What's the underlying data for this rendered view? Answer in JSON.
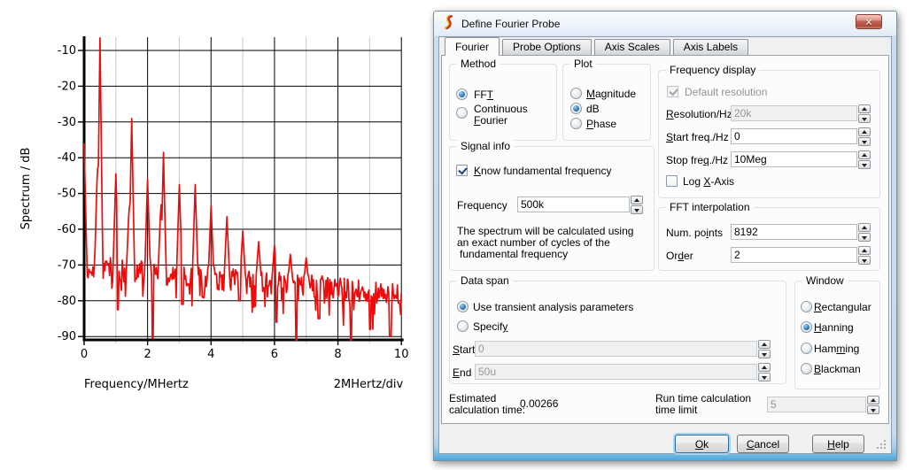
{
  "window": {
    "title": "Define Fourier Probe",
    "close_glyph": "✕"
  },
  "tabs": [
    {
      "label": "Fourier",
      "active": true
    },
    {
      "label": "Probe Options",
      "active": false
    },
    {
      "label": "Axis Scales",
      "active": false
    },
    {
      "label": "Axis Labels",
      "active": false
    }
  ],
  "fourier": {
    "method": {
      "title": "Method",
      "fft": {
        "label": "FFT",
        "selected": true
      },
      "continuous": {
        "label": "Continuous Fourier",
        "selected": false
      }
    },
    "plot": {
      "title": "Plot",
      "magnitude": {
        "label": "Magnitude",
        "selected": false
      },
      "db": {
        "label": "dB",
        "selected": true
      },
      "phase": {
        "label": "Phase",
        "selected": false
      }
    },
    "signal": {
      "title": "Signal info",
      "know": {
        "label": "Know fundamental frequency",
        "checked": true
      },
      "frequency": {
        "label": "Frequency",
        "value": "500k"
      },
      "note": [
        "The spectrum will be calculated using",
        "an exact number of cycles of the",
        "fundamental frequency"
      ]
    },
    "freq_display": {
      "title": "Frequency display",
      "default_res": {
        "label": "Default resolution",
        "checked": true,
        "disabled": true
      },
      "resolution": {
        "label": "Resolution/Hz",
        "value": "20k",
        "disabled": true
      },
      "start": {
        "label": "Start freq./Hz",
        "value": "0",
        "disabled": false
      },
      "stop": {
        "label": "Stop freq./Hz",
        "value": "10Meg",
        "disabled": false
      },
      "logx": {
        "label": "Log X-Axis",
        "checked": false
      }
    },
    "fft_interp": {
      "title": "FFT interpolation",
      "num_points": {
        "label": "Num. points",
        "value": "8192"
      },
      "order": {
        "label": "Order",
        "value": "2"
      }
    },
    "data_span": {
      "title": "Data span",
      "use_transient": {
        "label": "Use transient analysis parameters",
        "selected": true
      },
      "specify": {
        "label": "Specify",
        "selected": false
      },
      "start": {
        "label": "Start",
        "value": "0",
        "disabled": true
      },
      "end": {
        "label": "End",
        "value": "50u",
        "disabled": true
      }
    },
    "window_fn": {
      "title": "Window",
      "rectangular": {
        "label": "Rectangular",
        "selected": false
      },
      "hanning": {
        "label": "Hanning",
        "selected": true
      },
      "hamming": {
        "label": "Hamming",
        "selected": false
      },
      "blackman": {
        "label": "Blackman",
        "selected": false
      }
    },
    "estimated": {
      "line1": "Estimated",
      "line2": "calculation time:",
      "value": "0.00266"
    },
    "run_limit": {
      "line1": "Run time calculation",
      "line2": "time limit",
      "value": "5",
      "disabled": true
    }
  },
  "buttons": {
    "ok": "Ok",
    "cancel": "Cancel",
    "help": "Help"
  },
  "chart_data": {
    "type": "line",
    "title": "",
    "xlabel": "Frequency/MHertz",
    "xlabel_right": "2MHertz/div",
    "ylabel": "Spectrum / dB",
    "xlim": [
      0,
      10
    ],
    "ylim": [
      -91,
      -6.4
    ],
    "x_ticks": [
      0,
      2,
      4,
      6,
      8,
      10
    ],
    "x_minor_step": 1,
    "y_ticks": [
      -10,
      -20,
      -30,
      -40,
      -50,
      -60,
      -70,
      -80,
      -90
    ],
    "grid": true,
    "legend": "none",
    "line_color": "#ee0b0b",
    "series_name": "spectrum",
    "fundamental_hz": "500k",
    "harmonics_mhz_db": [
      [
        0.0,
        -36
      ],
      [
        0.42,
        -41.5
      ],
      [
        0.5,
        -6.5
      ],
      [
        1.0,
        -44.5
      ],
      [
        1.42,
        -53
      ],
      [
        1.5,
        -29
      ],
      [
        2.0,
        -46
      ],
      [
        2.42,
        -52
      ],
      [
        2.5,
        -38.5
      ],
      [
        3.0,
        -47.5
      ],
      [
        3.5,
        -47.5
      ],
      [
        4.0,
        -53.5
      ],
      [
        4.5,
        -56.5
      ],
      [
        5.0,
        -60.5
      ],
      [
        5.5,
        -63.5
      ],
      [
        6.0,
        -64.5
      ],
      [
        6.5,
        -67
      ],
      [
        7.0,
        -68
      ]
    ],
    "noise_floor": {
      "start": -70.6,
      "slope": -0.75,
      "jitter": 3.3,
      "spike_prob": 0.13,
      "spike_extra": 6
    },
    "notches_mhz_db": [
      [
        1.07,
        -82.5
      ],
      [
        2.17,
        -90.5
      ],
      [
        3.1,
        -81
      ],
      [
        3.75,
        -79
      ],
      [
        4.9,
        -80
      ],
      [
        6.07,
        -86
      ],
      [
        6.68,
        -91
      ],
      [
        7.4,
        -85
      ],
      [
        8.42,
        -92
      ],
      [
        9.02,
        -88
      ],
      [
        9.65,
        -90
      ]
    ],
    "sample_step": 0.025,
    "seed": 987654
  }
}
